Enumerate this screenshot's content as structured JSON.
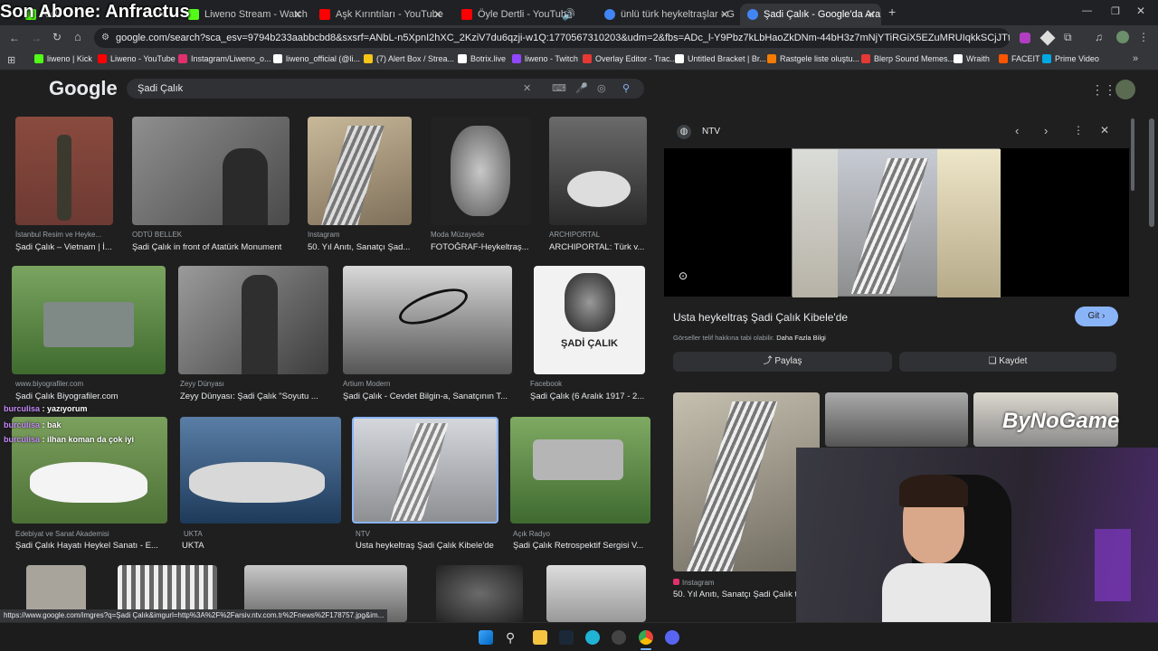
{
  "overlay": {
    "follow_text": "Son Abone: Anfractus"
  },
  "tabs": [
    {
      "title": "Kick",
      "color": "#53fc18"
    },
    {
      "title": "Liweno Stream - Watch Live on",
      "color": "#53fc18"
    },
    {
      "title": "Aşk Kırıntıları - YouTube",
      "color": "#ff0000"
    },
    {
      "title": "Öyle Dertli - YouTube",
      "color": "#ff0000"
    },
    {
      "title": "ünlü türk heykeltraşlar - Google",
      "color": "#4285f4"
    },
    {
      "title": "Şadi Çalık - Google'da Ara",
      "color": "#4285f4",
      "active": true
    }
  ],
  "address": {
    "url": "google.com/search?sca_esv=9794b233aabbcbd8&sxsrf=ANbL-n5XpnI2hXC_2KziV7du6qzji-w1Q:1770567310203&udm=2&fbs=ADc_l-Y9Pbz7kLbHaoZkDNm-44bH3z7mNjYTiRGiX5EZuMRUIqkkSCjJTf2kPHxrg64IlbmdyZIDWCg6rbv..."
  },
  "bookmarks": [
    {
      "label": "liweno | Kick",
      "color": "#53fc18"
    },
    {
      "label": "Liweno - YouTube",
      "color": "#ff0000"
    },
    {
      "label": "Instagram/Liweno_o...",
      "color": "#e1306c"
    },
    {
      "label": "liweno_official (@li...",
      "color": "#ffffff"
    },
    {
      "label": "(7) Alert Box / Strea...",
      "color": "#f5c518"
    },
    {
      "label": "Botrix.live",
      "color": "#ffffff"
    },
    {
      "label": "liweno - Twitch",
      "color": "#9146ff"
    },
    {
      "label": "Overlay Editor - Trac...",
      "color": "#e53935"
    },
    {
      "label": "Untitled Bracket | Br...",
      "color": "#ffffff"
    },
    {
      "label": "Rastgele liste oluştu...",
      "color": "#f57c00"
    },
    {
      "label": "Blerp Sound Memes...",
      "color": "#e53935"
    },
    {
      "label": "Wraith",
      "color": "#ffffff"
    },
    {
      "label": "FACEIT",
      "color": "#ff5500"
    },
    {
      "label": "Prime Video",
      "color": "#00a8e1"
    }
  ],
  "google": {
    "logo": "Google",
    "query": "Şadi Çalık"
  },
  "results": [
    {
      "src": "İstanbul Resim ve Heyke...",
      "title": "Şadi Çalık – Vietnam | İ..."
    },
    {
      "src": "ODTÜ BELLEK",
      "title": "Şadi Çalık in front of Atatürk Monument"
    },
    {
      "src": "Instagram",
      "title": "50. Yıl Anıtı, Sanatçı Şad..."
    },
    {
      "src": "Moda Müzayede",
      "title": "FOTOĞRAF-Heykeltraş..."
    },
    {
      "src": "ARCHIPORTAL",
      "title": "ARCHIPORTAL: Türk v..."
    },
    {
      "src": "www.biyografiler.com",
      "title": "Şadi Çalık Biyografiler.com"
    },
    {
      "src": "Zeyy Dünyası",
      "title": "Zeyy Dünyası: Şadi Çalık \"Soyutu ..."
    },
    {
      "src": "Artium Modern",
      "title": "Şadi Çalık - Cevdet Bilgin-a, Sanatçının T..."
    },
    {
      "src": "Facebook",
      "title": "Şadi Çalık (6 Aralık 1917 - 2..."
    },
    {
      "src": "Edebiyat ve Sanat Akademisi",
      "title": "Şadi Çalık Hayatı Heykel Sanatı - E..."
    },
    {
      "src": "UKTA",
      "title": "UKTA"
    },
    {
      "src": "NTV",
      "title": "Usta heykeltraş Şadi Çalık Kibele'de"
    },
    {
      "src": "Açık Radyo",
      "title": "Şadi Çalık Retrospektif Sergisi V..."
    }
  ],
  "chat": [
    {
      "user": "burculisa",
      "msg": "yazıyorum"
    },
    {
      "user": "burculisa",
      "msg": "bak"
    },
    {
      "user": "burculisa",
      "msg": "ilhan koman da çok iyi"
    }
  ],
  "preview": {
    "source": "NTV",
    "title": "Usta heykeltraş Şadi Çalık Kibele'de",
    "go_label": "Git",
    "copyright": "Görseller telif hakkına tabi olabilir.",
    "more_info": "Daha Fazla Bilgi",
    "share_label": "Paylaş",
    "save_label": "Kaydet",
    "related_src": "Instagram",
    "related_title": "50. Yıl Anıtı, Sanatçı Şadi Çalık t"
  },
  "watermark": "ByNoGame",
  "status_url": "https://www.google.com/imgres?q=Şadi Çalık&imgurl=http%3A%2F%2Farsiv.ntv.com.tr%2Fnews%2F178757.jpg&im..."
}
